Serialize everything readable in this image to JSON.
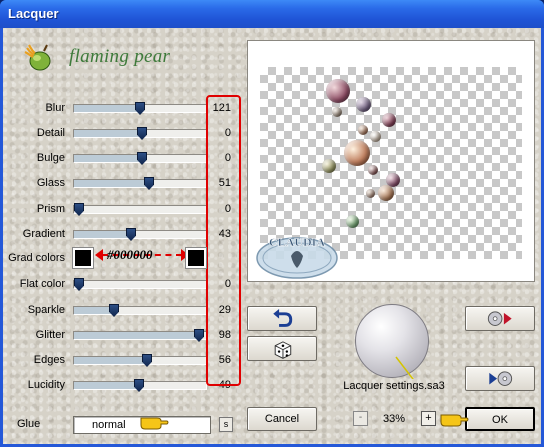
{
  "window": {
    "title": "Lacquer"
  },
  "brand": {
    "name": "flaming pear",
    "logo_icon": "pear-logo-icon"
  },
  "sliders": [
    {
      "label": "Blur",
      "value": "121",
      "fraction": 0.5
    },
    {
      "label": "Detail",
      "value": "0",
      "fraction": 0.52
    },
    {
      "label": "Bulge",
      "value": "0",
      "fraction": 0.52
    },
    {
      "label": "Glass",
      "value": "51",
      "fraction": 0.57
    },
    {
      "label": "Prism",
      "value": "0",
      "fraction": 0.0
    },
    {
      "label": "Gradient",
      "value": "43",
      "fraction": 0.43
    },
    {
      "label": "Flat color",
      "value": "0",
      "fraction": 0.0
    },
    {
      "label": "Sparkle",
      "value": "29",
      "fraction": 0.29
    },
    {
      "label": "Glitter",
      "value": "98",
      "fraction": 0.98
    },
    {
      "label": "Edges",
      "value": "56",
      "fraction": 0.56
    },
    {
      "label": "Lucidity",
      "value": "49",
      "fraction": 0.49
    }
  ],
  "grad_colors": {
    "label": "Grad colors",
    "annotation": "#000000",
    "color1": "#000000",
    "color2": "#000000"
  },
  "glue": {
    "label": "Glue",
    "value": "normal",
    "small_button": "s"
  },
  "preview": {
    "stamp_text": "CLAUDIA"
  },
  "buttons": {
    "undo_icon": "undo-arrow-icon",
    "random_icon": "dice-icon",
    "load_icon": "load-preset-icon",
    "save_icon": "save-preset-icon",
    "cancel": "Cancel",
    "ok": "OK"
  },
  "settings": {
    "label": "Lacquer settings.sa3"
  },
  "zoom": {
    "minus": "-",
    "value": "33%",
    "plus": "+"
  },
  "colors": {
    "annotation_red": "#e00000",
    "title_blue": "#2458d8"
  }
}
